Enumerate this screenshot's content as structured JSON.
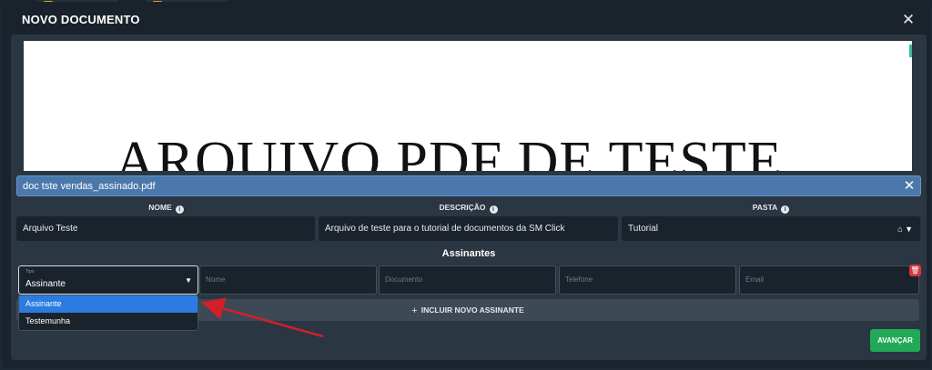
{
  "modal": {
    "title": "NOVO DOCUMENTO"
  },
  "pdf_preview": {
    "text": "ARQUIVO PDF DE TESTE"
  },
  "file": {
    "name": "doc tste vendas_assinado.pdf"
  },
  "fields": {
    "nome": {
      "label": "NOME",
      "value": "Arquivo Teste"
    },
    "descricao": {
      "label": "DESCRIÇÃO",
      "value": "Arquivo de teste para o tutorial de documentos da SM Click"
    },
    "pasta": {
      "label": "PASTA",
      "value": "Tutorial"
    }
  },
  "signers": {
    "title": "Assinantes",
    "tipo": {
      "label": "Tipo",
      "value": "Assinante",
      "options": [
        "Assinante",
        "Testemunha"
      ]
    },
    "placeholders": {
      "nome": "Nome",
      "documento": "Documento",
      "telefone": "Telefone",
      "email": "Email"
    },
    "add_label": "INCLUIR NOVO ASSINANTE"
  },
  "actions": {
    "next_label": "AVANÇAR"
  },
  "colors": {
    "accent": "#2b7be0",
    "success": "#21a958",
    "danger": "#d9363e",
    "file_bar": "#4b78ab",
    "annotation_arrow": "#d21f2a"
  }
}
